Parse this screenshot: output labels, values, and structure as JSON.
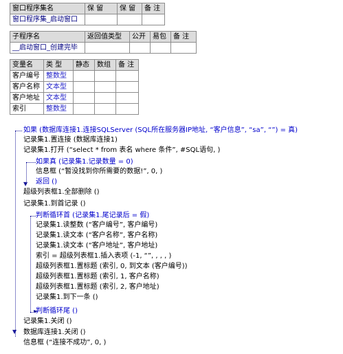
{
  "program_set_table": {
    "headers": [
      "窗口程序集名",
      "保 留",
      "保 留",
      "备 注"
    ],
    "row": [
      "窗口程序集_启动窗口",
      "",
      "",
      ""
    ]
  },
  "sub_table": {
    "headers": [
      "子程序名",
      "返回值类型",
      "公开",
      "易包",
      "备 注"
    ],
    "row": [
      "__启动窗口_创建完毕",
      "",
      "",
      "",
      ""
    ]
  },
  "var_table": {
    "headers": [
      "变量名",
      "类 型",
      "静态",
      "数组",
      "备 注"
    ],
    "rows": [
      [
        "客户编号",
        "整数型",
        "",
        "",
        ""
      ],
      [
        "客户名称",
        "文本型",
        "",
        "",
        ""
      ],
      [
        "客户地址",
        "文本型",
        "",
        "",
        ""
      ],
      [
        "索引",
        "整数型",
        "",
        "",
        ""
      ]
    ]
  },
  "code": [
    "如果 (数据库连接1.连接SQLServer (SQL所在服务器IP地址, “客户信息”, “sa”, “”) = 真)",
    "记录集1.置连接 (数据库连接1)",
    "记录集1.打开 (“select * from 表名 where 条件”, #SQL语句, )",
    "如果真 (记录集1.记录数量 = 0)",
    "信息框 (“暂没找到你所需要的数据!”, 0, )",
    "返回 ()",
    "超级列表框1.全部删除 ()",
    "记录集1.到首记录 ()",
    "判断循环首 (记录集1.尾记录后 = 假)",
    "记录集1.读整数 (“客户编号”, 客户编号)",
    "记录集1.读文本 (“客户名称”, 客户名称)",
    "记录集1.读文本 (“客户地址”, 客户地址)",
    "索引 = 超级列表框1.插入表项 (-1, “”, , , , )",
    "超级列表框1.置标题 (索引, 0, 到文本 (客户编号))",
    "超级列表框1.置标题 (索引, 1, 客户名称)",
    "超级列表框1.置标题 (索引, 2, 客户地址)",
    "记录集1.到下一条 ()",
    "判断循环尾 ()",
    "记录集1.关闭 ()",
    "数据库连接1.关闭 ()",
    "信息框 (“连接不成功”, 0, )"
  ]
}
